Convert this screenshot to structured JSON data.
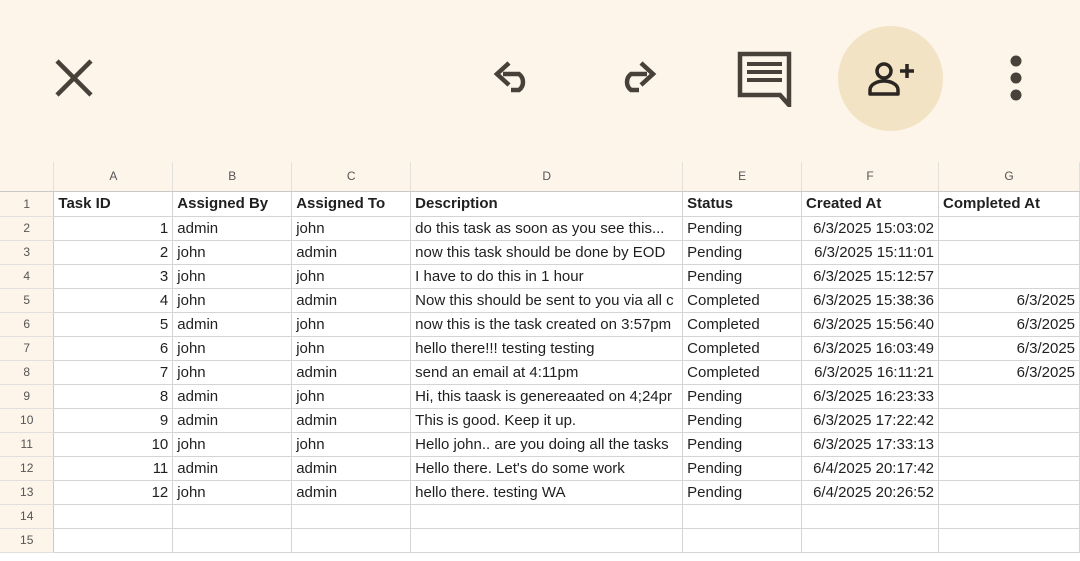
{
  "toolbar": {
    "close_icon": "close-icon",
    "undo_icon": "undo-icon",
    "redo_icon": "redo-icon",
    "comment_icon": "comment-icon",
    "share_icon": "add-person-icon",
    "more_icon": "more-vert-icon",
    "accent_color": "#f2e3c4",
    "background_color": "#fdf4ea"
  },
  "sheet": {
    "columns": [
      "A",
      "B",
      "C",
      "D",
      "E",
      "F",
      "G"
    ],
    "row_numbers": [
      "1",
      "2",
      "3",
      "4",
      "5",
      "6",
      "7",
      "8",
      "9",
      "10",
      "11",
      "12",
      "13",
      "14",
      "15"
    ],
    "header": {
      "task_id": "Task ID",
      "assigned_by": "Assigned By",
      "assigned_to": "Assigned To",
      "description": "Description",
      "status": "Status",
      "created_at": "Created At",
      "completed_at": "Completed At"
    },
    "rows": [
      {
        "id": "1",
        "by": "admin",
        "to": "john",
        "desc": "do this task as soon as you see this...",
        "status": "Pending",
        "created": "6/3/2025 15:03:02",
        "completed": ""
      },
      {
        "id": "2",
        "by": "john",
        "to": "admin",
        "desc": "now this task should be done by EOD",
        "status": "Pending",
        "created": "6/3/2025 15:11:01",
        "completed": ""
      },
      {
        "id": "3",
        "by": "john",
        "to": "john",
        "desc": "I have to do this in 1 hour",
        "status": "Pending",
        "created": "6/3/2025 15:12:57",
        "completed": ""
      },
      {
        "id": "4",
        "by": "john",
        "to": "admin",
        "desc": "Now this should be sent to you via all c",
        "status": "Completed",
        "created": "6/3/2025 15:38:36",
        "completed": "6/3/2025"
      },
      {
        "id": "5",
        "by": "admin",
        "to": "john",
        "desc": "now this is the task created on 3:57pm",
        "status": "Completed",
        "created": "6/3/2025 15:56:40",
        "completed": "6/3/2025"
      },
      {
        "id": "6",
        "by": "john",
        "to": "john",
        "desc": "hello there!!! testing testing",
        "status": "Completed",
        "created": "6/3/2025 16:03:49",
        "completed": "6/3/2025"
      },
      {
        "id": "7",
        "by": "john",
        "to": "admin",
        "desc": "send an email at 4:11pm",
        "status": "Completed",
        "created": "6/3/2025 16:11:21",
        "completed": "6/3/2025"
      },
      {
        "id": "8",
        "by": "admin",
        "to": "john",
        "desc": "Hi, this taask is genereaated on 4;24pr",
        "status": "Pending",
        "created": "6/3/2025 16:23:33",
        "completed": ""
      },
      {
        "id": "9",
        "by": "admin",
        "to": "admin",
        "desc": "This is good. Keep it up.",
        "status": "Pending",
        "created": "6/3/2025 17:22:42",
        "completed": ""
      },
      {
        "id": "10",
        "by": "john",
        "to": "john",
        "desc": "Hello john.. are you doing all the tasks",
        "status": "Pending",
        "created": "6/3/2025 17:33:13",
        "completed": ""
      },
      {
        "id": "11",
        "by": "admin",
        "to": "admin",
        "desc": "Hello there. Let's do some work",
        "status": "Pending",
        "created": "6/4/2025 20:17:42",
        "completed": ""
      },
      {
        "id": "12",
        "by": "john",
        "to": "admin",
        "desc": "hello there. testing WA",
        "status": "Pending",
        "created": "6/4/2025 20:26:52",
        "completed": ""
      }
    ]
  }
}
